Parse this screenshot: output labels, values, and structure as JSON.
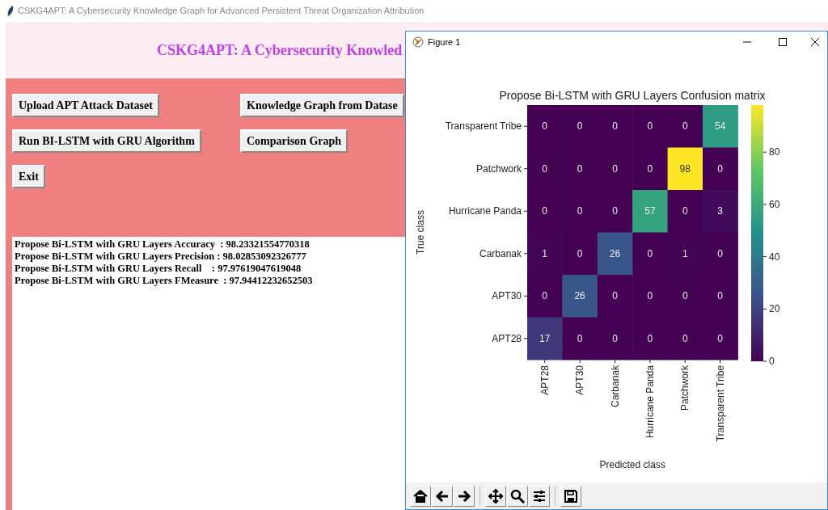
{
  "window": {
    "title": "CSKG4APT: A Cybersecurity Knowledge Graph for Advanced Persistent Threat Organization Attribution"
  },
  "header": {
    "title": "CSKG4APT: A Cybersecurity Knowled"
  },
  "buttons": [
    {
      "label": "Upload APT Attack Dataset"
    },
    {
      "label": "Knowledge Graph from Datase"
    },
    {
      "label": "Run BI-LSTM with GRU Algorithm"
    },
    {
      "label": "Comparison Graph"
    },
    {
      "label": "Exit"
    }
  ],
  "output_lines": [
    "Propose Bi-LSTM with GRU Layers Accuracy  : 98.23321554770318",
    "Propose Bi-LSTM with GRU Layers Precision : 98.02853092326777",
    "Propose Bi-LSTM with GRU Layers Recall    : 97.97619047619048",
    "Propose Bi-LSTM with GRU Layers FMeasure  : 97.94412232652503"
  ],
  "figure_window": {
    "title": "Figure 1",
    "confusion_matrix": {
      "title": "Propose Bi-LSTM with GRU Layers Confusion matrix",
      "xlabel": "Predicted class",
      "ylabel": "True class",
      "x": [
        "APT28",
        "APT30",
        "Carbanak",
        "Hurricane Panda",
        "Patchwork",
        "Transparent Tribe"
      ],
      "y": [
        "Transparent Tribe",
        "Patchwork",
        "Hurricane Panda",
        "Carbanak",
        "APT30",
        "APT28"
      ],
      "values": [
        [
          "0",
          "0",
          "0",
          "0",
          "0",
          "54"
        ],
        [
          "0",
          "0",
          "0",
          "0",
          "98",
          "0"
        ],
        [
          "0",
          "0",
          "0",
          "57",
          "0",
          "3"
        ],
        [
          "1",
          "0",
          "26",
          "0",
          "1",
          "0"
        ],
        [
          "0",
          "26",
          "0",
          "0",
          "0",
          "0"
        ],
        [
          "17",
          "0",
          "0",
          "0",
          "0",
          "0"
        ]
      ],
      "colorbar_ticks": [
        "80",
        "60",
        "40",
        "20",
        "0"
      ]
    }
  }
}
